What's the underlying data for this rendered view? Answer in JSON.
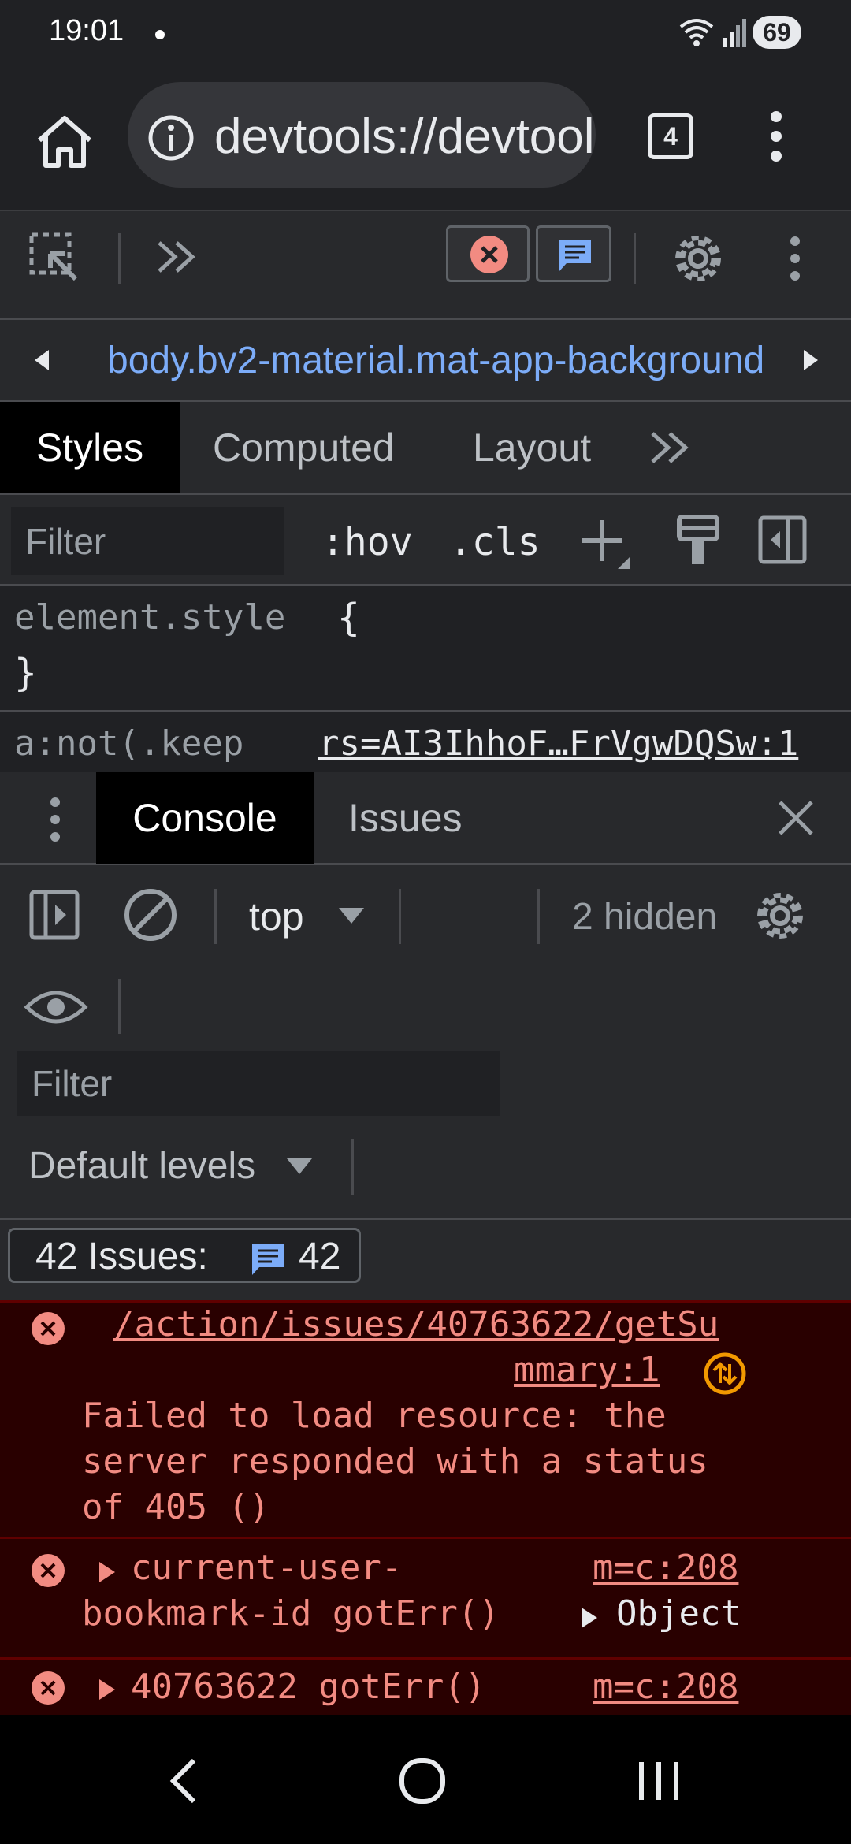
{
  "status_bar": {
    "time": "19:01",
    "battery": "69"
  },
  "browser": {
    "url": "devtools://devtools/bundled/devtools_app.html",
    "tab_count": "4"
  },
  "devtools": {
    "breadcrumb": "body.bv2-material.mat-app-background",
    "styles_tabs": [
      "Styles",
      "Computed",
      "Layout"
    ],
    "styles_active_tab": "Styles",
    "filter_placeholder": "Filter",
    "hov_label": ":hov",
    "cls_label": ".cls",
    "element_style_selector": "element.style",
    "open_brace": "{",
    "close_brace": "}",
    "rule_selector": "a:not(.keep",
    "rule_source": "rs=AI3IhhoF…FrVgwDQSw:1"
  },
  "drawer": {
    "tabs": [
      "Console",
      "Issues"
    ],
    "active_tab": "Console"
  },
  "console": {
    "context": "top",
    "hidden_count": "2 hidden",
    "filter_placeholder": "Filter",
    "levels": "Default levels",
    "issues_label": "42 Issues:",
    "issues_count": "42",
    "errors": [
      {
        "link_line1": "/action/issues/40763622/getSu",
        "link_line2": "mmary:1",
        "message_lines": [
          "Failed to load resource: the",
          "server responded with a status",
          "of 405 ()"
        ]
      },
      {
        "text_line1": "current-user-",
        "text_line2": "bookmark-id gotErr()",
        "source": "m=c:208",
        "object_label": "Object"
      },
      {
        "text_line1": "40763622 gotErr()",
        "source": "m=c:208"
      }
    ]
  },
  "colors": {
    "background": "#202124",
    "panel": "#28292c",
    "link_blue": "#7cacf8",
    "error_bg": "#290000",
    "error_text": "#f28b82",
    "error_icon": "#f28b82",
    "warning_icon": "#f29900"
  }
}
